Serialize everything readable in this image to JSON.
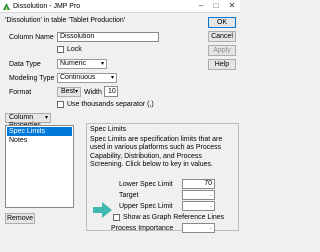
{
  "window": {
    "title": "Dissolution - JMP Pro",
    "controls": {
      "minimize": "–",
      "maximize": "□",
      "close": "✕"
    }
  },
  "dialog": {
    "caption": "'Dissolution' in table 'Tablet Production'",
    "column_name_label": "Column Name",
    "column_name_value": "Dissolution",
    "lock_label": "Lock",
    "data_type_label": "Data Type",
    "data_type_value": "Numeric",
    "modeling_type_label": "Modeling Type",
    "modeling_type_value": "Continuous",
    "format_label": "Format",
    "format_value": "Best",
    "width_label": "Width",
    "width_value": "10",
    "thousands_label": "Use thousands separator (,)"
  },
  "buttons": {
    "ok": "OK",
    "cancel": "Cancel",
    "apply": "Apply",
    "help": "Help",
    "column_properties": "Column Properties",
    "remove": "Remove"
  },
  "properties_list": [
    "Spec Limits",
    "Notes"
  ],
  "spec_panel": {
    "title": "Spec Limits",
    "description": "Spec Limits are specification limits that are used in various platforms such as Process Capability, Distribution, and Process Screening. Click below to key in values.",
    "lsl_label": "Lower Spec Limit",
    "lsl_value": "70",
    "target_label": "Target",
    "target_value": ".",
    "usl_label": "Upper Spec Limit",
    "usl_value": ".",
    "show_ref_label": "Show as Graph Reference Lines",
    "importance_label": "Process Importance",
    "importance_value": "."
  },
  "colors": {
    "accent": "#0078d7",
    "arrow": "#3fb8b0"
  },
  "icons": {
    "app": "jmp-icon",
    "arrow": "teal-arrow-icon"
  }
}
